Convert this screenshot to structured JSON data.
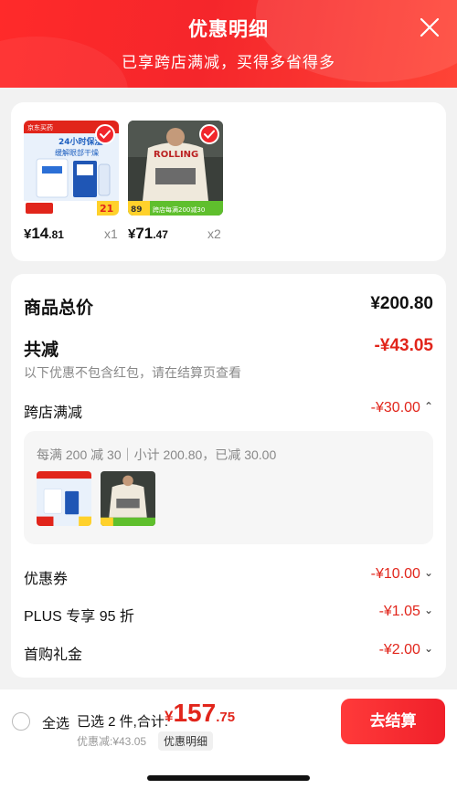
{
  "header": {
    "title": "优惠明细",
    "subtitle": "已享跨店满减，买得多省得多"
  },
  "products": [
    {
      "image_texts": [
        "京东买药",
        "24小时保湿",
        "缓解眼部干燥",
        "21"
      ],
      "price_symbol": "¥",
      "price_int": "14",
      "price_dec": ".81",
      "quantity": "x1",
      "selected": true
    },
    {
      "image_texts": [
        "ROLLING",
        "89",
        "跨店每满200减30"
      ],
      "price_symbol": "¥",
      "price_int": "71",
      "price_dec": ".47",
      "quantity": "x2",
      "selected": true
    }
  ],
  "summary": {
    "total_label": "商品总价",
    "total_value": "¥200.80",
    "reduction_label": "共减",
    "reduction_value": "-¥43.05",
    "note": "以下优惠不包含红包，请在结算页查看",
    "cross_store": {
      "label": "跨店满减",
      "value": "-¥30.00",
      "rule": "每满 200 减 30｜小计 200.80，已减 30.00"
    },
    "items": [
      {
        "label": "优惠券",
        "value": "-¥10.00"
      },
      {
        "label": "PLUS 专享 95 折",
        "value": "-¥1.05"
      },
      {
        "label": "首购礼金",
        "value": "-¥2.00"
      }
    ]
  },
  "bottom_bar": {
    "select_all": "全选",
    "selected_text": "已选 2 件,合计:",
    "total_symbol": "¥",
    "total_int": "157",
    "total_dec": ".75",
    "discount_text": "优惠减:¥43.05",
    "detail_tag": "优惠明细",
    "checkout_label": "去结算"
  },
  "colors": {
    "accent": "#e1251b",
    "header": "#f5262b",
    "background": "#f2f2f2"
  },
  "icons": [
    "close-icon",
    "check-icon",
    "chevron-up-icon",
    "chevron-down-icon",
    "radio-icon"
  ]
}
